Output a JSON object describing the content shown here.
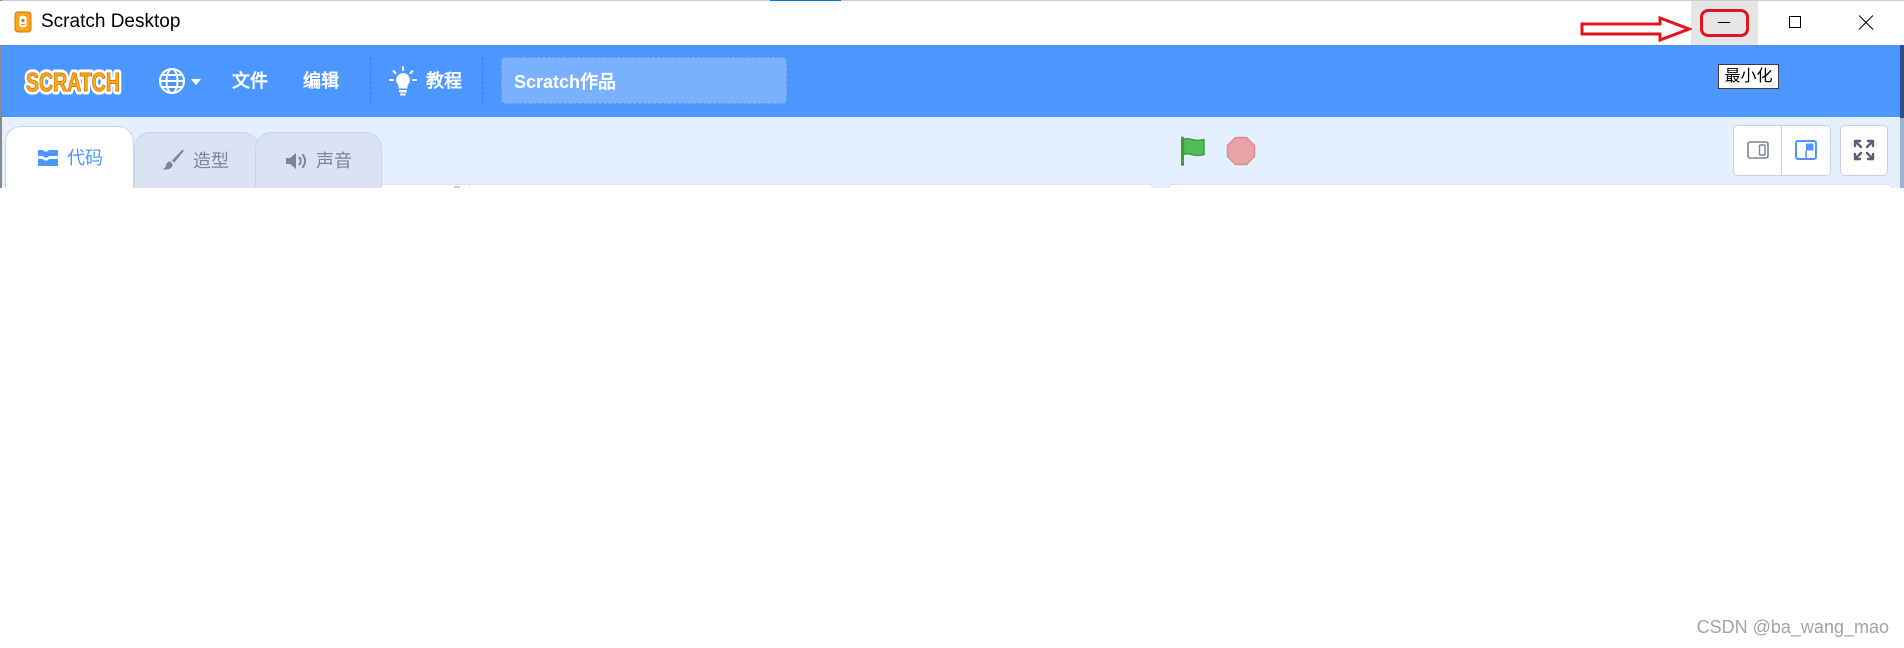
{
  "window": {
    "title": "Scratch Desktop",
    "app_icon": "scratch-desktop-icon",
    "controls": {
      "minimize_icon": "minimize-icon",
      "maximize_icon": "maximize-icon",
      "close_icon": "close-icon"
    },
    "tooltip": "最小化"
  },
  "annotation": {
    "color": "#e0141e"
  },
  "menu_bar": {
    "logo_text": "SCRATCH",
    "language_icon": "globe-icon",
    "file": "文件",
    "edit": "编辑",
    "tutorials": "教程",
    "tutorials_icon": "lightbulb-icon",
    "project_title": "Scratch作品"
  },
  "tabs": [
    {
      "label": "代码",
      "icon": "code-icon",
      "selected": true
    },
    {
      "label": "造型",
      "icon": "brush-icon",
      "selected": false
    },
    {
      "label": "声音",
      "icon": "speaker-icon",
      "selected": false
    }
  ],
  "stage_controls": {
    "green_flag_icon": "green-flag-icon",
    "stop_icon": "stop-icon",
    "small_stage_icon": "small-stage-icon",
    "normal_stage_icon": "normal-stage-icon",
    "selected_stage_size": "normal",
    "fullscreen_icon": "fullscreen-icon"
  },
  "watermark": "CSDN @ba_wang_mao",
  "colors": {
    "primary": "#4c97ff",
    "workspace_background": "#e5f0ff",
    "green_flag": "#4cbf56",
    "stop": "#ec5959",
    "logo": "#ffab19"
  }
}
